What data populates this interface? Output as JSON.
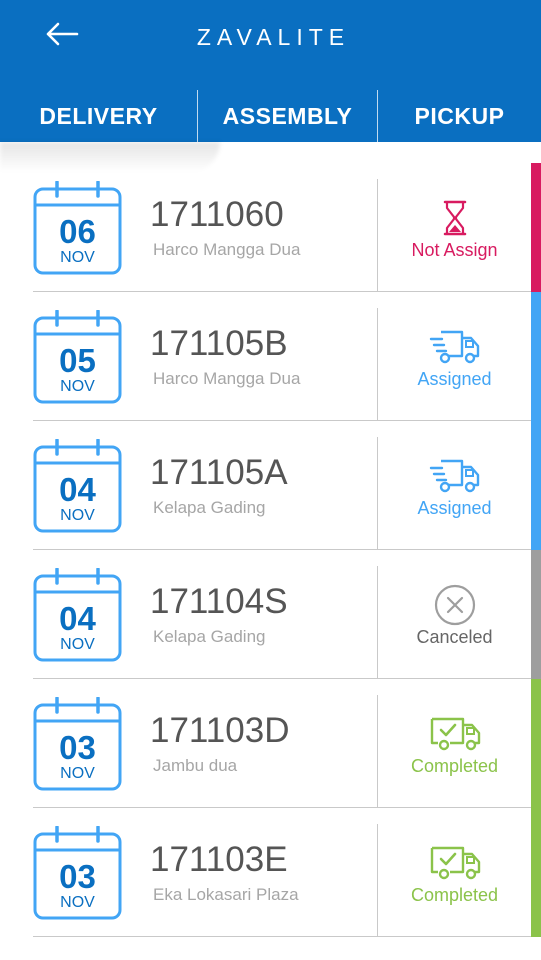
{
  "app": {
    "title": "ZAVALITE"
  },
  "colors": {
    "brand": "#0a6fc1",
    "not_assign": "#d81b60",
    "assigned": "#42a5f5",
    "canceled": "#9e9e9e",
    "completed": "#8bc34a"
  },
  "tabs": [
    {
      "label": "DELIVERY",
      "active": true
    },
    {
      "label": "ASSEMBLY",
      "active": false
    },
    {
      "label": "PICKUP",
      "active": false
    }
  ],
  "orders": [
    {
      "day": "06",
      "month": "NOV",
      "number": "1711060",
      "location": "Harco Mangga Dua",
      "status": "Not Assign",
      "status_icon": "hourglass-icon"
    },
    {
      "day": "05",
      "month": "NOV",
      "number": "171105B",
      "location": "Harco Mangga Dua",
      "status": "Assigned",
      "status_icon": "delivery-truck-icon"
    },
    {
      "day": "04",
      "month": "NOV",
      "number": "171105A",
      "location": "Kelapa Gading",
      "status": "Assigned",
      "status_icon": "delivery-truck-icon"
    },
    {
      "day": "04",
      "month": "NOV",
      "number": "171104S",
      "location": "Kelapa Gading",
      "status": "Canceled",
      "status_icon": "cancel-circle-icon"
    },
    {
      "day": "03",
      "month": "NOV",
      "number": "171103D",
      "location": "Jambu dua",
      "status": "Completed",
      "status_icon": "truck-check-icon"
    },
    {
      "day": "03",
      "month": "NOV",
      "number": "171103E",
      "location": "Eka Lokasari Plaza",
      "status": "Completed",
      "status_icon": "truck-check-icon"
    }
  ]
}
